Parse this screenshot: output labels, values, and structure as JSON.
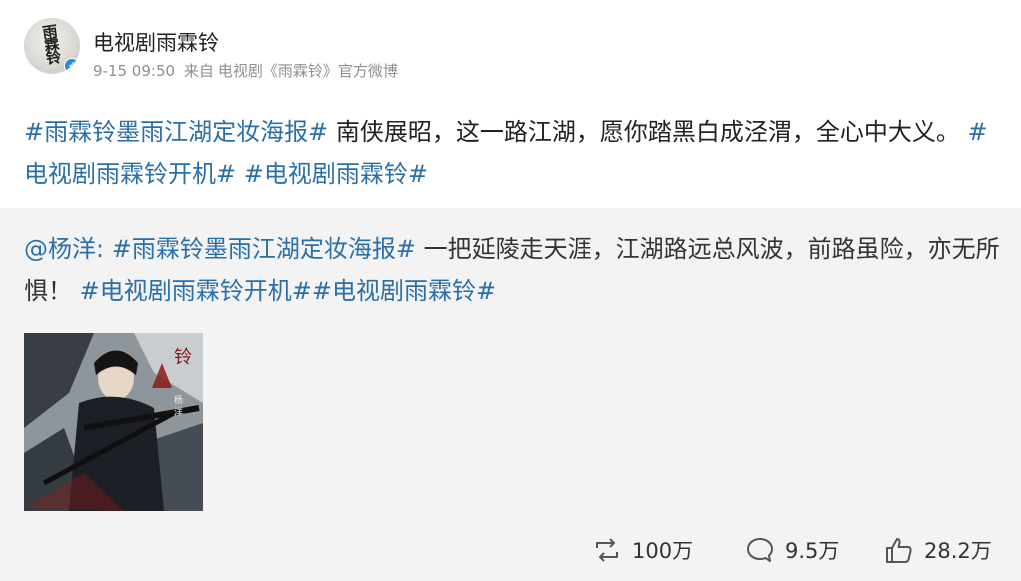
{
  "author": {
    "name": "电视剧雨霖铃",
    "avatar_text": "雨霖铃",
    "verified_icon": "verified-badge-icon"
  },
  "meta": {
    "time": "9-15 09:50",
    "source_prefix": "来自",
    "source": "电视剧《雨霖铃》官方微博"
  },
  "post": {
    "tag1": "#雨霖铃墨雨江湖定妆海报#",
    "text1": " 南侠展昭，这一路江湖，愿你踏黑白成泾渭，全心中大义。",
    "tag2": "#电视剧雨霖铃开机#",
    "tag3": "#电视剧雨霖铃#"
  },
  "repost": {
    "mention": "@杨洋",
    "colon": ": ",
    "tag1": "#雨霖铃墨雨江湖定妆海报#",
    "text1": " 一把延陵走天涯，江湖路远总风波，前路虽险，亦无所惧！",
    "tag2": "#电视剧雨霖铃开机#",
    "tag3": "#电视剧雨霖铃#",
    "image_desc_icon": "poster-image"
  },
  "actions": {
    "repost_count": "100万",
    "comment_count": "9.5万",
    "like_count": "28.2万"
  },
  "colors": {
    "link": "#2b6fa8",
    "repost_bg": "#f3f3f3",
    "text": "#222222",
    "meta": "#8f8f8f"
  }
}
